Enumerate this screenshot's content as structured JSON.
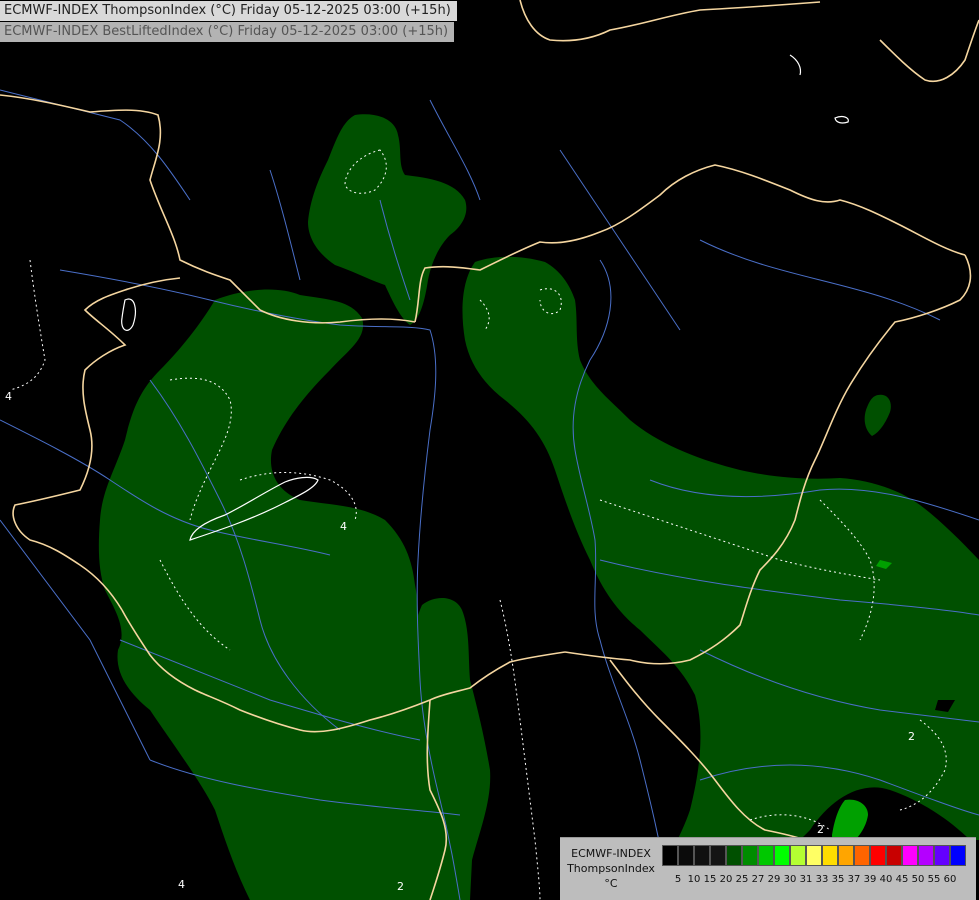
{
  "header": {
    "line1": "ECMWF-INDEX ThompsonIndex (°C) Friday 05-12-2025 03:00 (+15h)",
    "line2": "ECMWF-INDEX BestLiftedIndex (°C) Friday 05-12-2025 03:00 (+15h)"
  },
  "contour_labels": [
    "4",
    "4",
    "2",
    "2",
    "4",
    "2"
  ],
  "legend": {
    "caption_lines": [
      "ECMWF-INDEX",
      "ThompsonIndex",
      "°C"
    ],
    "ticks": [
      "5",
      "10",
      "15",
      "20",
      "25",
      "27",
      "29",
      "30",
      "31",
      "33",
      "35",
      "37",
      "39",
      "40",
      "45",
      "50",
      "55",
      "60"
    ],
    "colors": [
      "#000000",
      "#0b0b0b",
      "#101010",
      "#141414",
      "#005000",
      "#008c00",
      "#00c800",
      "#00ff00",
      "#b4ff32",
      "#ffff64",
      "#ffdc00",
      "#ffa500",
      "#ff6400",
      "#ff0000",
      "#c80000",
      "#ff00ff",
      "#b400ff",
      "#6400ff",
      "#0000ff"
    ]
  },
  "colors": {
    "background": "#000000",
    "index_fill": "#005000",
    "index_fill_high": "#00a000",
    "borders": "#f5d6a0",
    "rivers": "#4a6fc8",
    "contours": "#ffffff"
  }
}
